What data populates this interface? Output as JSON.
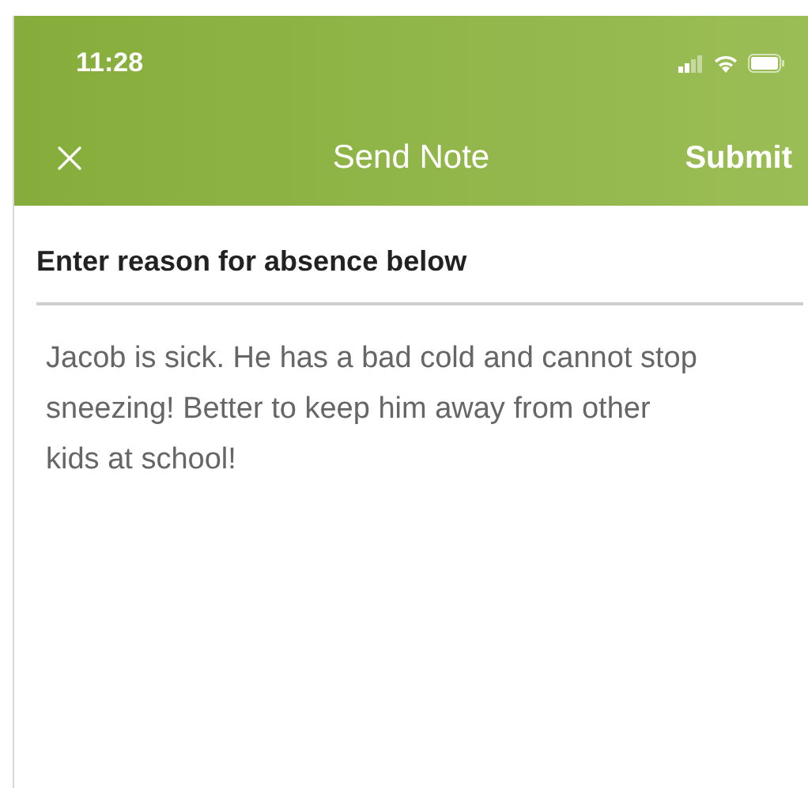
{
  "status_bar": {
    "time": "11:28"
  },
  "nav_bar": {
    "title": "Send Note",
    "action": "Submit"
  },
  "form": {
    "label": "Enter reason for absence below",
    "value": "Jacob is sick. He has a bad cold and cannot stop sneezing! Better to keep him away from other kids at school!"
  }
}
